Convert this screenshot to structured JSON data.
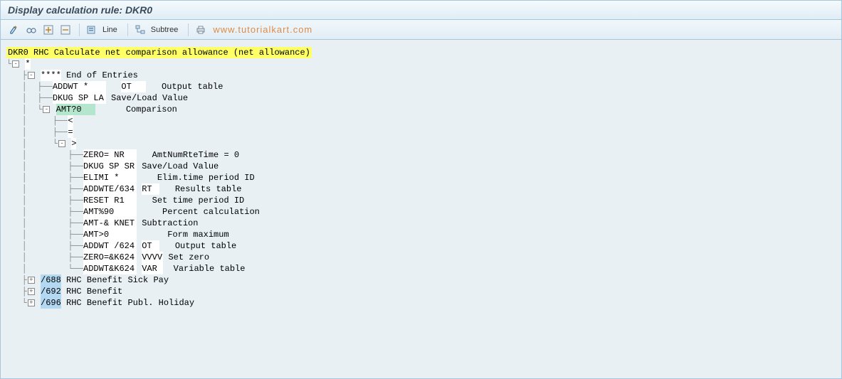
{
  "header": {
    "title": "Display calculation rule: DKR0"
  },
  "toolbar": {
    "line_label": "Line",
    "subtree_label": "Subtree"
  },
  "watermark": "www.tutorialkart.com",
  "tree": {
    "root": "DKR0 RHC Calculate net comparison allowance (net allowance)",
    "l1_star": "*",
    "l2_stars": "****",
    "l2_desc": "End of Entries",
    "l3_addwt_code": "ADDWT *",
    "l3_addwt_col": "OT",
    "l3_addwt_desc": "Output table",
    "l3_dkug_code": "DKUG SP LA",
    "l3_dkug_desc": "Save/Load Value",
    "l3_amt_code": "AMT?0",
    "l3_amt_desc": "Comparison",
    "l4_lt": "<",
    "l4_eq": "=",
    "l4_gt": ">",
    "l5_zero_code": "ZERO= NR",
    "l5_zero_desc": "AmtNumRteTime = 0",
    "l5_dkug_code": "DKUG SP SR",
    "l5_dkug_desc": "Save/Load Value",
    "l5_elimi_code": "ELIMI *",
    "l5_elimi_desc": "Elim.time period ID",
    "l5_addwte_code": "ADDWTE/634",
    "l5_addwte_col": "RT",
    "l5_addwte_desc": "Results table",
    "l5_reset_code": "RESET R1",
    "l5_reset_desc": "Set time period ID",
    "l5_amt90_code": "AMT%90",
    "l5_amt90_desc": "Percent calculation",
    "l5_amtknet_code": "AMT-& KNET",
    "l5_amtknet_desc": "Subtraction",
    "l5_amt0_code": "AMT>0",
    "l5_amt0_desc": "Form maximum",
    "l5_addwt624_code": "ADDWT /624",
    "l5_addwt624_col": "OT",
    "l5_addwt624_desc": "Output table",
    "l5_zerok_code": "ZERO=&K624",
    "l5_zerok_col": "VVVV",
    "l5_zerok_desc": "Set zero",
    "l5_addwtk_code": "ADDWT&K624",
    "l5_addwtk_col": "VAR",
    "l5_addwtk_desc": "Variable table",
    "n688_code": "/688",
    "n688_desc": "RHC Benefit Sick Pay",
    "n692_code": "/692",
    "n692_desc": "RHC Benefit",
    "n696_code": "/696",
    "n696_desc": "RHC Benefit Publ. Holiday"
  }
}
